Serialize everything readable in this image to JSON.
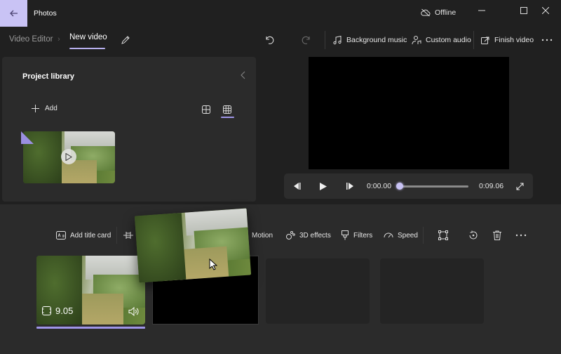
{
  "titlebar": {
    "app_title": "Photos",
    "status": "Offline",
    "back_icon": "arrow-left-icon",
    "status_icon": "cloud-offline-icon",
    "window_controls": [
      "minimize",
      "maximize",
      "close"
    ]
  },
  "toolbar": {
    "breadcrumb": {
      "root": "Video Editor",
      "current": "New video"
    },
    "rename_icon": "pencil-icon",
    "undo_icon": "undo-icon",
    "redo_icon": "redo-icon",
    "background_music": "Background music",
    "custom_audio": "Custom audio",
    "finish_video": "Finish video",
    "more_icon": "more-icon"
  },
  "library": {
    "title": "Project library",
    "add_label": "Add",
    "view_options": [
      "small-grid",
      "large-grid"
    ],
    "selected_view": "large-grid",
    "items": [
      {
        "type": "video",
        "thumbnail": "grassy path between sugarcane fields",
        "in_storyboard": true
      }
    ]
  },
  "player": {
    "current_time": "0:00.00",
    "total_time": "0:09.06",
    "progress": 0.0
  },
  "storyboard": {
    "actions": {
      "add_title_card": "Add title card",
      "trim": "Trim",
      "motion": "Motion",
      "effects_3d": "3D effects",
      "filters": "Filters",
      "speed": "Speed"
    },
    "clips": [
      {
        "duration": "9.05",
        "audio": true,
        "selected": true,
        "type": "video"
      },
      {
        "type": "blank",
        "color": "#000000"
      },
      {
        "type": "empty"
      },
      {
        "type": "empty"
      }
    ]
  },
  "colors": {
    "accent": "#9f95e8",
    "accent_light": "#c9c3f5",
    "background": "#202020",
    "panel": "#2b2b2b"
  }
}
